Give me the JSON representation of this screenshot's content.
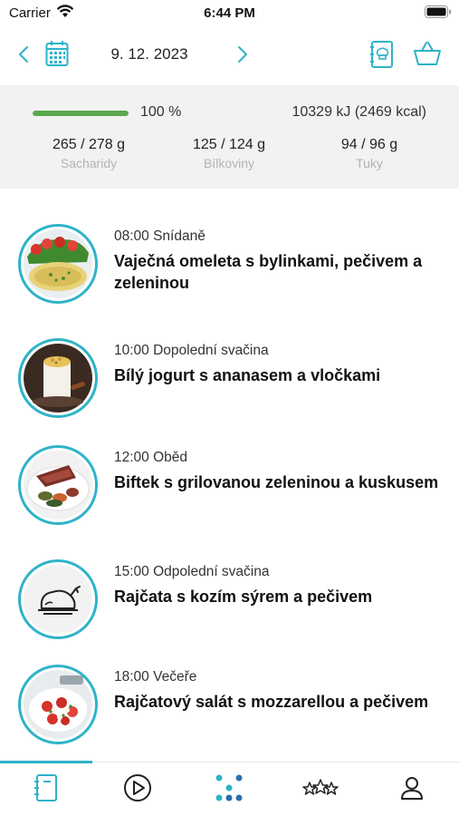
{
  "status_bar": {
    "carrier": "Carrier",
    "time": "6:44 PM"
  },
  "date_nav": {
    "date": "9. 12. 2023"
  },
  "summary": {
    "progress_fraction": 1.0,
    "percent_label": "100 %",
    "energy": "10329 kJ (2469 kcal)",
    "macros": [
      {
        "value": "265 / 278 g",
        "label": "Sacharidy"
      },
      {
        "value": "125 / 124 g",
        "label": "Bílkoviny"
      },
      {
        "value": "94 / 96 g",
        "label": "Tuky"
      }
    ]
  },
  "meals": [
    {
      "time_label": "08:00 Snídaně",
      "title": "Vaječná omeleta s bylinkami, pečivem a zeleninou",
      "thumb_icon": "omelette-photo"
    },
    {
      "time_label": "10:00 Dopolední svačina",
      "title": "Bílý jogurt s ananasem a vločkami",
      "thumb_icon": "yogurt-photo"
    },
    {
      "time_label": "12:00 Oběd",
      "title": "Biftek s grilovanou zeleninou a kuskusem",
      "thumb_icon": "steak-photo"
    },
    {
      "time_label": "15:00 Odpolední svačina",
      "title": "Rajčata s kozím sýrem a pečivem",
      "thumb_icon": "roast-chicken-placeholder-icon"
    },
    {
      "time_label": "18:00 Večeře",
      "title": "Rajčatový salát s mozzarellou a pečivem",
      "thumb_icon": "salad-photo"
    }
  ],
  "tabbar": {
    "tabs": [
      {
        "icon": "menu-book-icon",
        "active": true
      },
      {
        "icon": "play-icon",
        "active": false
      },
      {
        "icon": "dots-icon",
        "active": false
      },
      {
        "icon": "stars-icon",
        "active": false
      },
      {
        "icon": "profile-icon",
        "active": false
      }
    ]
  },
  "colors": {
    "accent": "#2eb3c8",
    "progress": "#5aa84e",
    "summary_bg": "#f2f2f2"
  }
}
